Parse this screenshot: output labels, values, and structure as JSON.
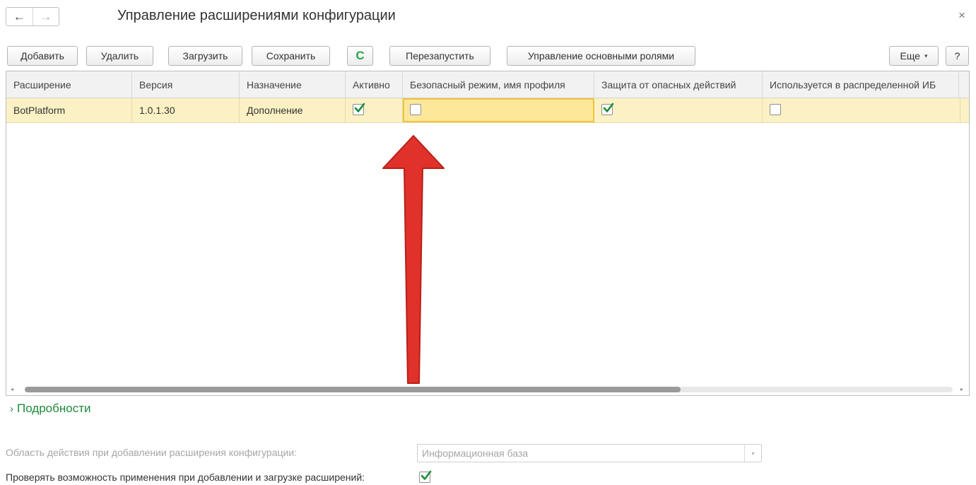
{
  "window": {
    "title": "Управление расширениями конфигурации",
    "back_icon": "←",
    "forward_icon": "→",
    "close_icon": "×"
  },
  "toolbar": {
    "add_label": "Добавить",
    "delete_label": "Удалить",
    "load_label": "Загрузить",
    "save_label": "Сохранить",
    "refresh_icon": "C",
    "restart_label": "Перезапустить",
    "roles_label": "Управление основными ролями",
    "more_label": "Еще",
    "more_caret": "▾",
    "help_label": "?"
  },
  "grid": {
    "columns": [
      "Расширение",
      "Версия",
      "Назначение",
      "Активно",
      "Безопасный режим, имя профиля",
      "Защита от опасных действий",
      "Используется в распределенной ИБ"
    ],
    "rows": [
      {
        "name": "BotPlatform",
        "version": "1.0.1.30",
        "purpose": "Дополнение",
        "active": true,
        "safe_mode": false,
        "danger_protection": true,
        "distributed_ib": false
      }
    ],
    "scroll_left_icon": "◂",
    "scroll_right_icon": "▸",
    "horizontal_scroll_fraction": 0.707
  },
  "details": {
    "chevron": "›",
    "label": "Подробности"
  },
  "scope": {
    "label": "Область действия при добавлении расширения конфигурации:",
    "value": "Информационная база",
    "dropdown_icon": "▾"
  },
  "check_applicability": {
    "label": "Проверять возможность применения при добавлении и загрузке расширений:",
    "checked": true
  },
  "colors": {
    "selected_row": "#fbf1c4",
    "focused_cell": "#fde89a",
    "accent_green": "#1e8c3a",
    "annotation_arrow": "#e0322a"
  }
}
